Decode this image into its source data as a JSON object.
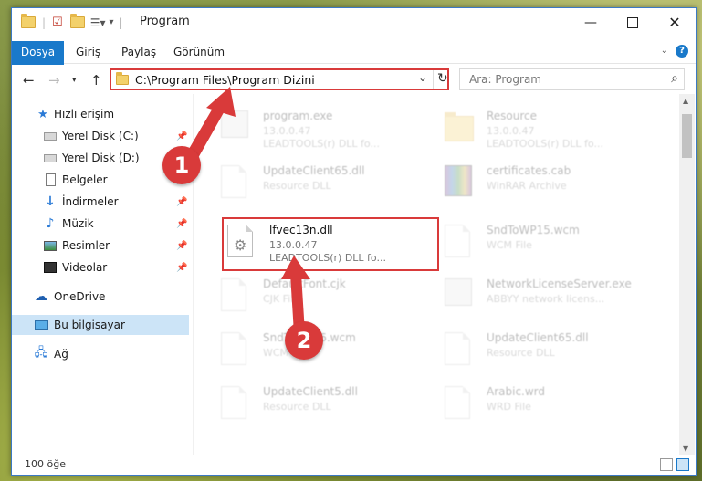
{
  "window": {
    "title": "Program"
  },
  "ribbon": {
    "tabs": [
      "Dosya",
      "Giriş",
      "Paylaş",
      "Görünüm"
    ]
  },
  "address": {
    "path": "C:\\Program Files\\Program Dizini"
  },
  "search": {
    "placeholder": "Ara: Program"
  },
  "sidebar": {
    "items": [
      {
        "label": "Hızlı erişim",
        "icon": "star-icon"
      },
      {
        "label": "Yerel Disk (C:)",
        "icon": "drive-icon",
        "pinned": true
      },
      {
        "label": "Yerel Disk (D:)",
        "icon": "drive-icon",
        "pinned": true
      },
      {
        "label": "Belgeler",
        "icon": "document-icon",
        "pinned": true
      },
      {
        "label": "İndirmeler",
        "icon": "download-icon",
        "pinned": true
      },
      {
        "label": "Müzik",
        "icon": "music-icon",
        "pinned": true
      },
      {
        "label": "Resimler",
        "icon": "pictures-icon",
        "pinned": true
      },
      {
        "label": "Videolar",
        "icon": "video-icon",
        "pinned": true
      },
      {
        "label": "OneDrive",
        "icon": "cloud-icon"
      },
      {
        "label": "Bu bilgisayar",
        "icon": "computer-icon",
        "selected": true
      },
      {
        "label": "Ağ",
        "icon": "network-icon"
      }
    ]
  },
  "files": [
    {
      "name": "program.exe",
      "l1": "13.0.0.47",
      "l2": "LEADTOOLS(r) DLL fo...",
      "icon": "exe-icon"
    },
    {
      "name": "Resource",
      "l1": "13.0.0.47",
      "l2": "LEADTOOLS(r) DLL fo...",
      "icon": "folder-icon"
    },
    {
      "name": "UpdateClient65.dll",
      "l1": "Resource DLL",
      "l2": "",
      "icon": "dll-icon"
    },
    {
      "name": "certificates.cab",
      "l1": "WinRAR Archive",
      "l2": "",
      "icon": "archive-icon"
    },
    {
      "name": "lfvec13n.dll",
      "l1": "13.0.0.47",
      "l2": "LEADTOOLS(r) DLL fo...",
      "icon": "dll-gear-icon"
    },
    {
      "name": "SndToWP15.wcm",
      "l1": "WCM File",
      "l2": "",
      "icon": "file-icon"
    },
    {
      "name": "DefaultFont.cjk",
      "l1": "CJK File",
      "l2": "",
      "icon": "file-icon"
    },
    {
      "name": "NetworkLicenseServer.exe",
      "l1": "ABBYY network licens...",
      "l2": "",
      "icon": "exe-icon"
    },
    {
      "name": "SndToWP16.wcm",
      "l1": "WCM File",
      "l2": "",
      "icon": "file-icon"
    },
    {
      "name": "UpdateClient65.dll",
      "l1": "Resource DLL",
      "l2": "",
      "icon": "dll-icon"
    },
    {
      "name": "UpdateClient5.dll",
      "l1": "Resource DLL",
      "l2": "",
      "icon": "dll-icon"
    },
    {
      "name": "Arabic.wrd",
      "l1": "WRD File",
      "l2": "",
      "icon": "file-icon"
    }
  ],
  "status": {
    "count": "100 öğe"
  },
  "callouts": {
    "one": "1",
    "two": "2"
  },
  "colors": {
    "accent": "#1979ca",
    "annotation": "#d93a3a"
  }
}
